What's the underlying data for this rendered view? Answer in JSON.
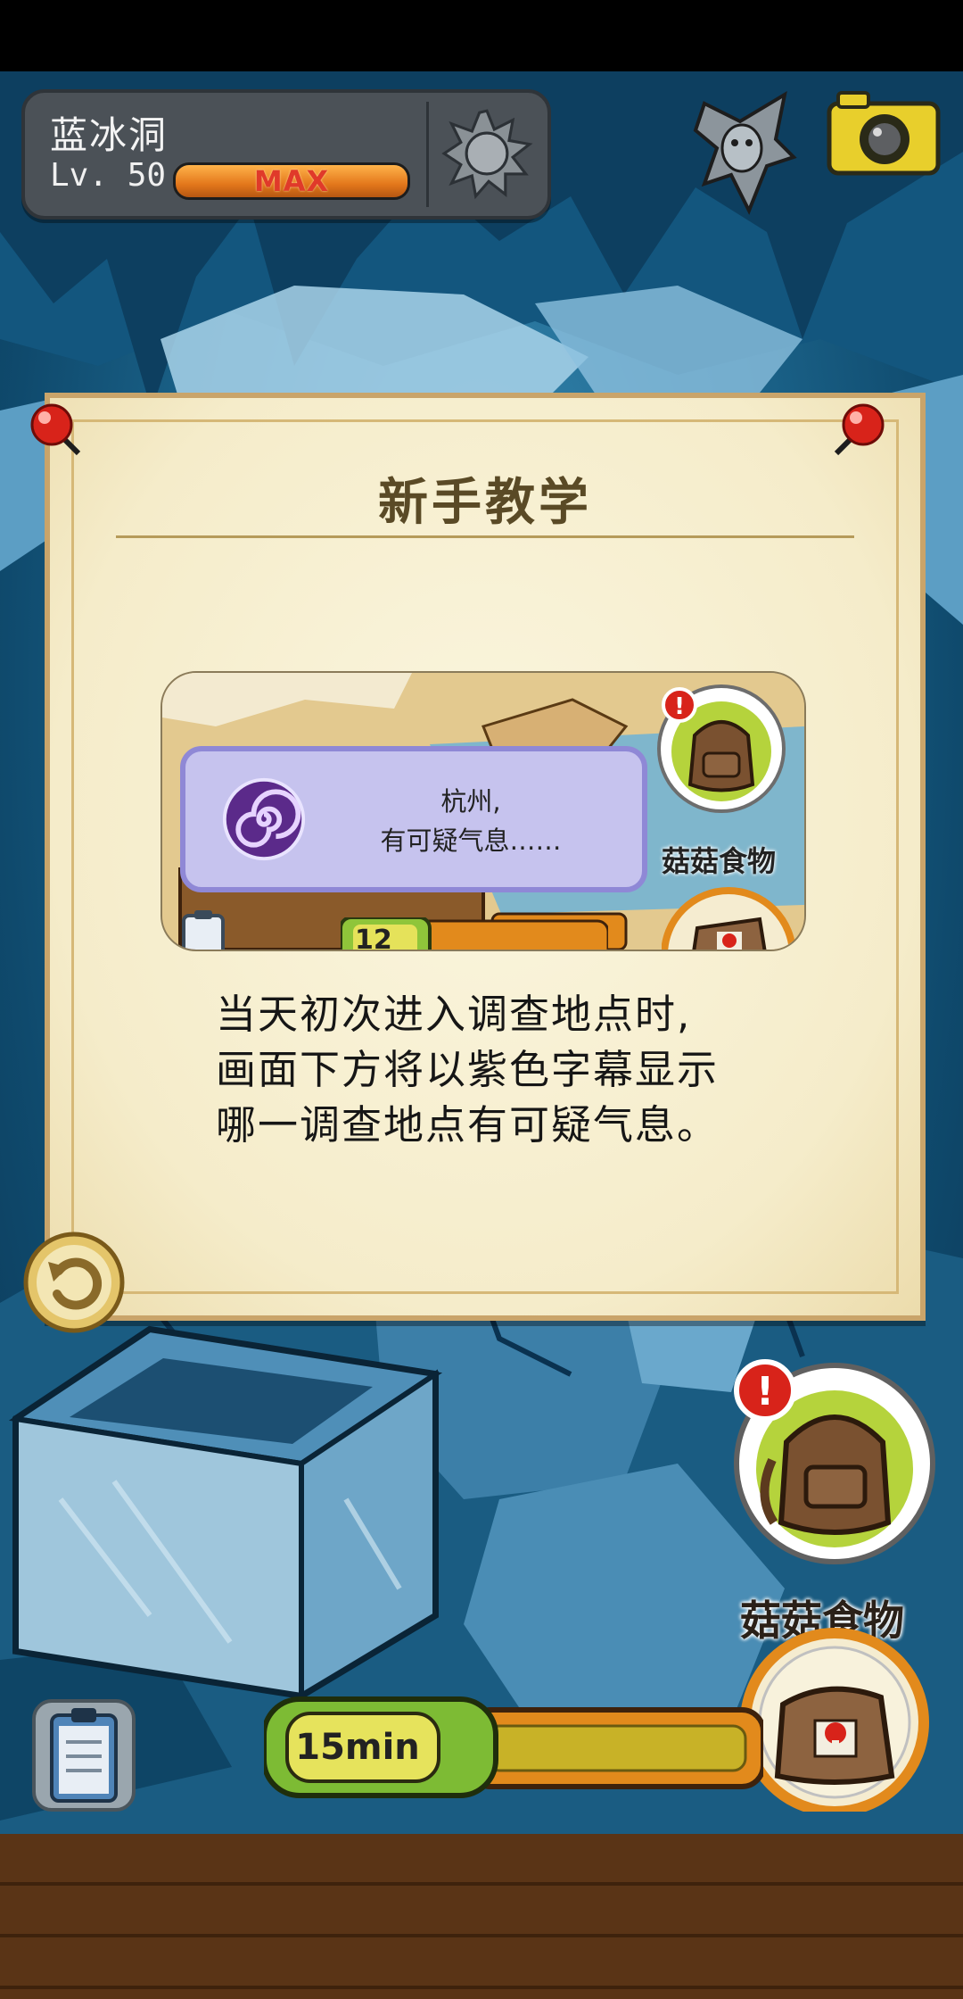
{
  "location": {
    "name": "蓝冰洞",
    "level": "Lv. 50",
    "level_badge": "MAX",
    "exp_fraction": 1.0
  },
  "tutorial": {
    "title": "新手教学",
    "preview": {
      "notice_lines": [
        "杭州,",
        "有可疑气息……"
      ],
      "food_label": "菇菇食物",
      "timer_text": "12"
    },
    "description_lines": [
      "当天初次进入调查地点时,",
      "画面下方将以紫色字幕显示",
      "哪一调查地点有可疑气息。"
    ]
  },
  "bottom": {
    "food_label": "菇菇食物",
    "timer_text": "15min"
  },
  "icons": [
    "sun-icon",
    "mascot-icon",
    "camera-icon",
    "pushpin-icon",
    "refresh-icon",
    "backpack-icon",
    "alert-icon",
    "food-bag-icon",
    "clipboard-icon",
    "spiral-icon"
  ],
  "colors": {
    "accent_orange": "#e3771b",
    "alert_red": "#d8231a",
    "notice_purple": "#8f88d6",
    "parchment": "#f5ecca"
  }
}
